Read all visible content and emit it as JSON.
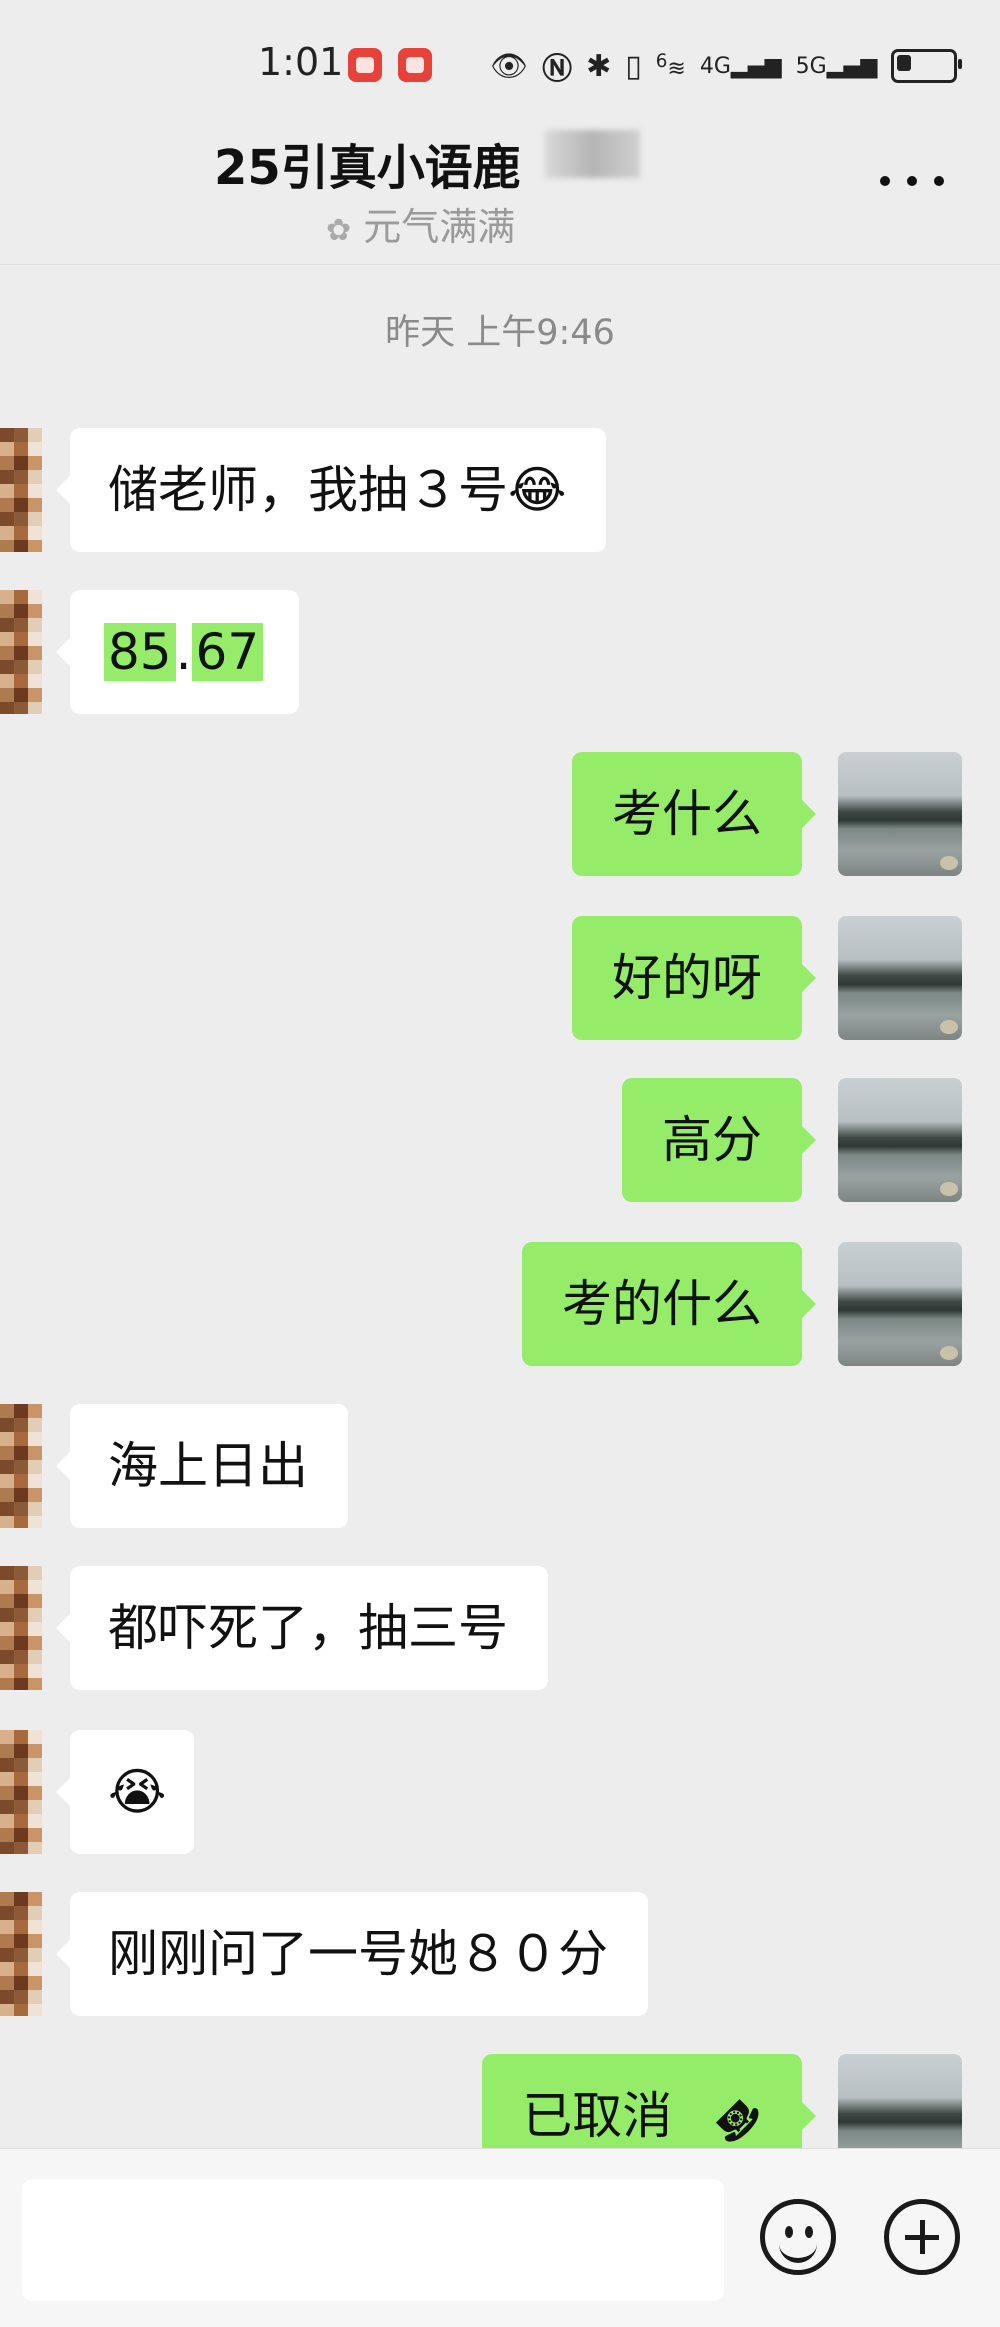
{
  "status_bar": {
    "time": "1:01",
    "icons": [
      "eye-icon",
      "nfc-icon",
      "bluetooth-icon",
      "vibrate-icon",
      "wifi-icon",
      "signal-4g-icon",
      "signal-5g-icon",
      "battery-icon"
    ],
    "network_4g": "4G",
    "network_5g": "5G",
    "wifi_label": "6"
  },
  "header": {
    "title": "25引真小语鹿",
    "subtitle": "元气满满"
  },
  "timestamp": "昨天 上午9:46",
  "messages": [
    {
      "side": "left",
      "text": "储老师，我抽３号😂"
    },
    {
      "side": "left",
      "text_a": "85",
      "text_b": ".",
      "text_c": "67"
    },
    {
      "side": "right",
      "text": "考什么"
    },
    {
      "side": "right",
      "text": "好的呀"
    },
    {
      "side": "right",
      "text": "高分"
    },
    {
      "side": "right",
      "text": "考的什么"
    },
    {
      "side": "left",
      "text": "海上日出"
    },
    {
      "side": "left",
      "text": "都吓死了，抽三号"
    },
    {
      "side": "left",
      "text": "😭"
    },
    {
      "side": "left",
      "text": "刚刚问了一号她８０分"
    },
    {
      "side": "right",
      "text": "已取消",
      "icon": "phone-hangup-icon"
    }
  ],
  "colors": {
    "background": "#ededed",
    "outgoing_bubble": "#95ec69",
    "incoming_bubble": "#ffffff"
  }
}
